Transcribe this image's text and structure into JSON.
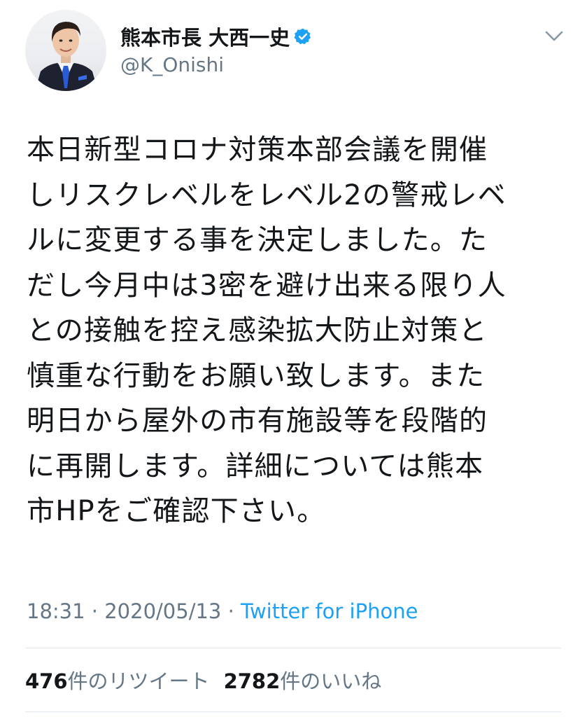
{
  "author": {
    "display_name": "熊本市長 大西一史",
    "handle": "@K_Onishi",
    "avatar_icon": "person-photo-avatar",
    "verified_icon": "verified-badge-icon",
    "menu_icon": "chevron-down-icon"
  },
  "tweet": {
    "text": "本日新型コロナ対策本部会議を開催\nしリスクレベルをレベル2の警戒レベ\nルに変更する事を決定しました。た\nだし今月中は3密を避け出来る限り人\nとの接触を控え感染拡大防止対策と\n慎重な行動をお願い致します。また\n明日から屋外の市有施設等を段階的\nに再開します。詳細については熊本\n市HPをご確認下さい。"
  },
  "meta": {
    "time": "18:31",
    "separator": "·",
    "date": "2020/05/13",
    "source": "Twitter for iPhone"
  },
  "stats": {
    "retweets_count": "476",
    "retweets_label": "件のリツイート",
    "likes_count": "2782",
    "likes_label": "件のいいね"
  },
  "colors": {
    "text": "#14171a",
    "secondary": "#657786",
    "link": "#1da1f2",
    "verified": "#1da1f2",
    "divider": "#e1e8ed"
  }
}
